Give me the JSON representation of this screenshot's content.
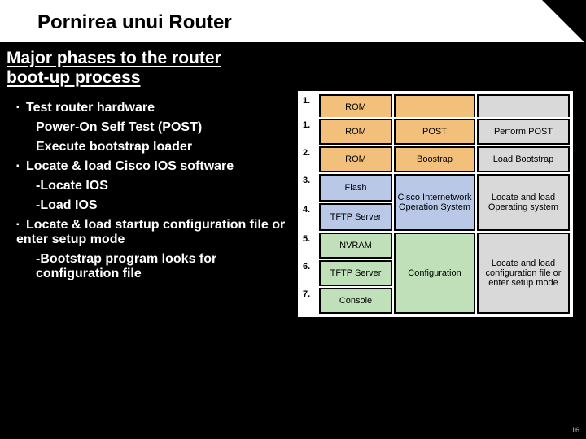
{
  "title": "Pornirea unui  Router",
  "subtitle": "Major phases to the router boot-up process",
  "page_number": "16",
  "bullets": [
    {
      "level": 1,
      "text": "Test router hardware"
    },
    {
      "level": 2,
      "text": "Power-On Self Test (POST)"
    },
    {
      "level": 2,
      "text": "Execute bootstrap loader"
    },
    {
      "level": 1,
      "text": "Locate & load Cisco IOS software"
    },
    {
      "level": 2,
      "text": "-Locate IOS"
    },
    {
      "level": 2,
      "text": "-Load IOS"
    },
    {
      "level": 1,
      "text": "Locate & load startup configuration file or enter setup mode"
    },
    {
      "level": 2,
      "text": "-Bootstrap program looks for configuration file"
    }
  ],
  "diagram": {
    "rows": {
      "r1": {
        "num": "1.",
        "c1": "ROM"
      },
      "r2": {
        "num": "2.",
        "c1": "ROM"
      },
      "g1_c2": "POST",
      "g1_c3": "Perform POST",
      "g2_c2": "Boostrap",
      "g2_c3": "Load Bootstrap",
      "r3": {
        "num": "3.",
        "c1": "Flash"
      },
      "r4": {
        "num": "4.",
        "c1": "TFTP Server"
      },
      "g3_c2": "Cisco Internetwork Operation System",
      "g3_c3": "Locate and load Operating system",
      "r5": {
        "num": "5.",
        "c1": "NVRAM"
      },
      "r6": {
        "num": "6.",
        "c1": "TFTP Server"
      },
      "r7": {
        "num": "7.",
        "c1": "Console"
      },
      "g4_c2": "Configuration",
      "g4_c3": "Locate and load configuration file or enter setup mode"
    }
  }
}
